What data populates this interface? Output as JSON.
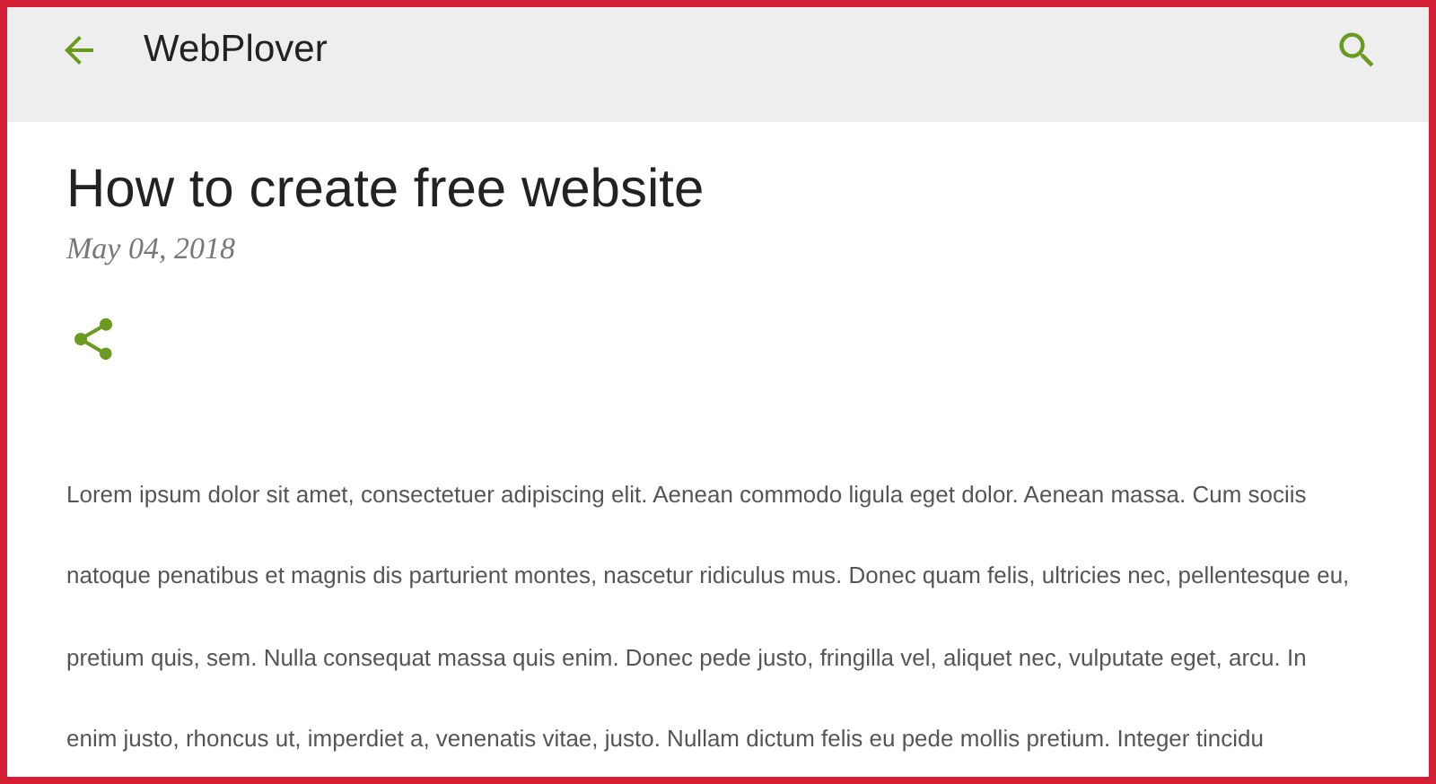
{
  "app_bar": {
    "title": "WebPlover"
  },
  "post": {
    "title": "How to create free website",
    "date": "May 04, 2018",
    "body_lines": [
      "Lorem ipsum dolor sit amet, consectetuer adipiscing elit. Aenean commodo ligula eget dolor. Aenean massa. Cum sociis",
      "natoque penatibus et magnis dis parturient montes, nascetur ridiculus mus. Donec quam felis, ultricies nec, pellentesque eu,",
      "pretium quis, sem. Nulla consequat massa quis enim. Donec pede justo, fringilla vel, aliquet nec, vulputate eget, arcu. In",
      "enim justo, rhoncus ut, imperdiet a, venenatis vitae, justo. Nullam dictum felis eu pede mollis pretium. Integer tincidu"
    ]
  }
}
